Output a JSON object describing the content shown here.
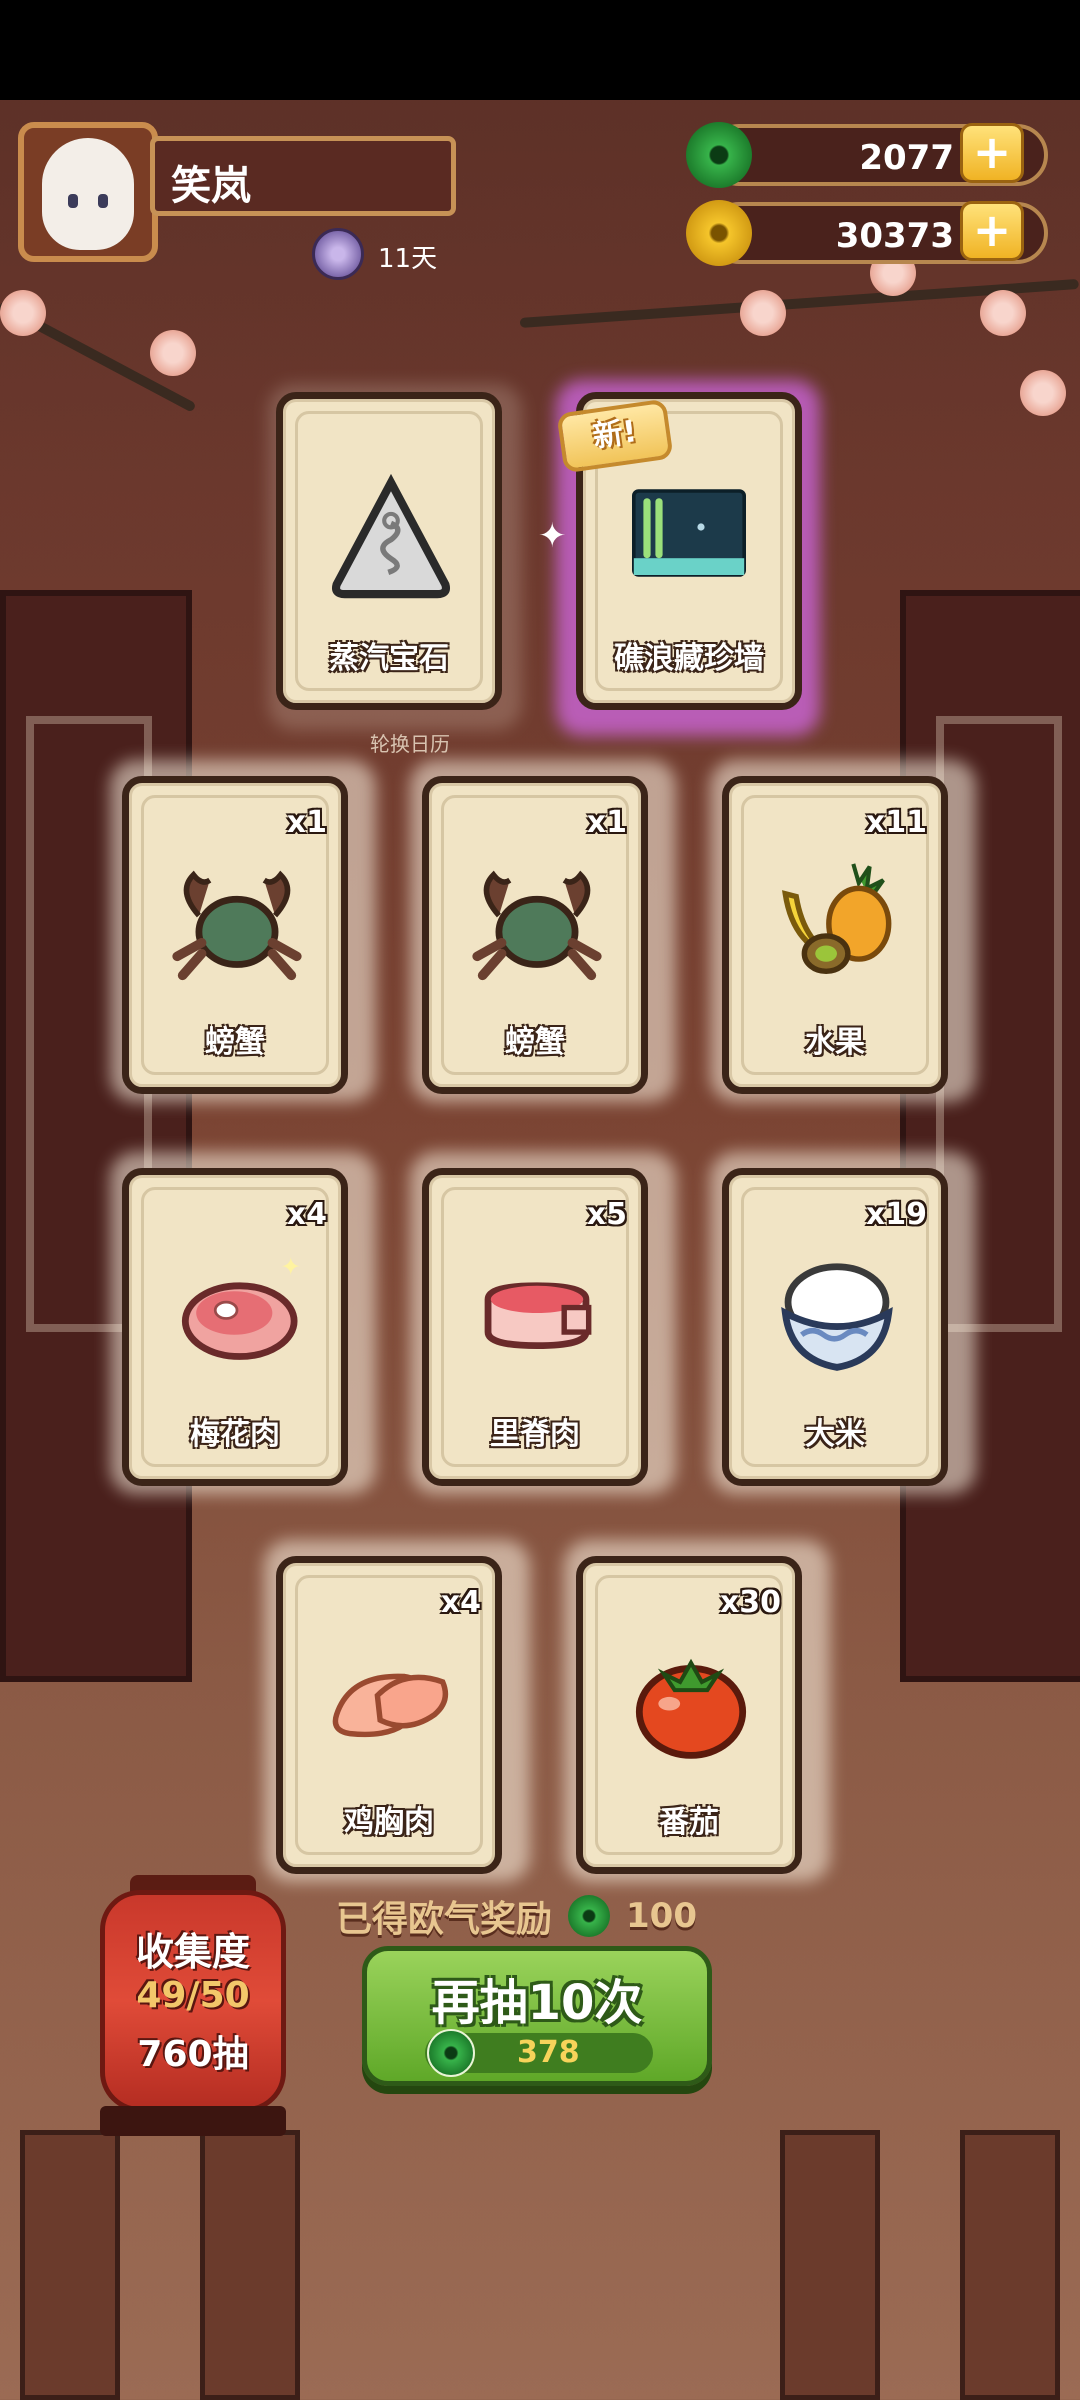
{
  "player": {
    "name": "笑岚",
    "days": "11天"
  },
  "currency": {
    "jade": "2077",
    "coins": "30373"
  },
  "calendar_label": "轮换日历",
  "new_badge": "新!",
  "cards": [
    {
      "name": "蒸汽宝石",
      "qty": "",
      "icon": "steam-gem-icon",
      "highlight": "none"
    },
    {
      "name": "礁浪藏珍墙",
      "qty": "",
      "icon": "reef-treasure-wall-icon",
      "highlight": "purple",
      "is_new": true
    },
    {
      "name": "螃蟹",
      "qty": "x1",
      "icon": "crab-icon",
      "highlight": "white"
    },
    {
      "name": "螃蟹",
      "qty": "x1",
      "icon": "crab-icon",
      "highlight": "white"
    },
    {
      "name": "水果",
      "qty": "x11",
      "icon": "fruit-icon",
      "highlight": "white"
    },
    {
      "name": "梅花肉",
      "qty": "x4",
      "icon": "pork-shoulder-icon",
      "highlight": "white"
    },
    {
      "name": "里脊肉",
      "qty": "x5",
      "icon": "tenderloin-icon",
      "highlight": "white"
    },
    {
      "name": "大米",
      "qty": "x19",
      "icon": "rice-bowl-icon",
      "highlight": "white"
    },
    {
      "name": "鸡胸肉",
      "qty": "x4",
      "icon": "chicken-breast-icon",
      "highlight": "white"
    },
    {
      "name": "番茄",
      "qty": "x30",
      "icon": "tomato-icon",
      "highlight": "white"
    }
  ],
  "reward": {
    "label": "已得欧气奖励",
    "value": "100"
  },
  "draw_button": {
    "title": "再抽10次",
    "cost": "378"
  },
  "collection": {
    "title": "收集度",
    "progress": "49/50",
    "draws": "760抽"
  },
  "colors": {
    "jade": "#37b34a",
    "coin": "#f5c52b",
    "draw_button": "#7cc043",
    "lantern": "#d8402f",
    "new_glow": "#e06eff"
  }
}
